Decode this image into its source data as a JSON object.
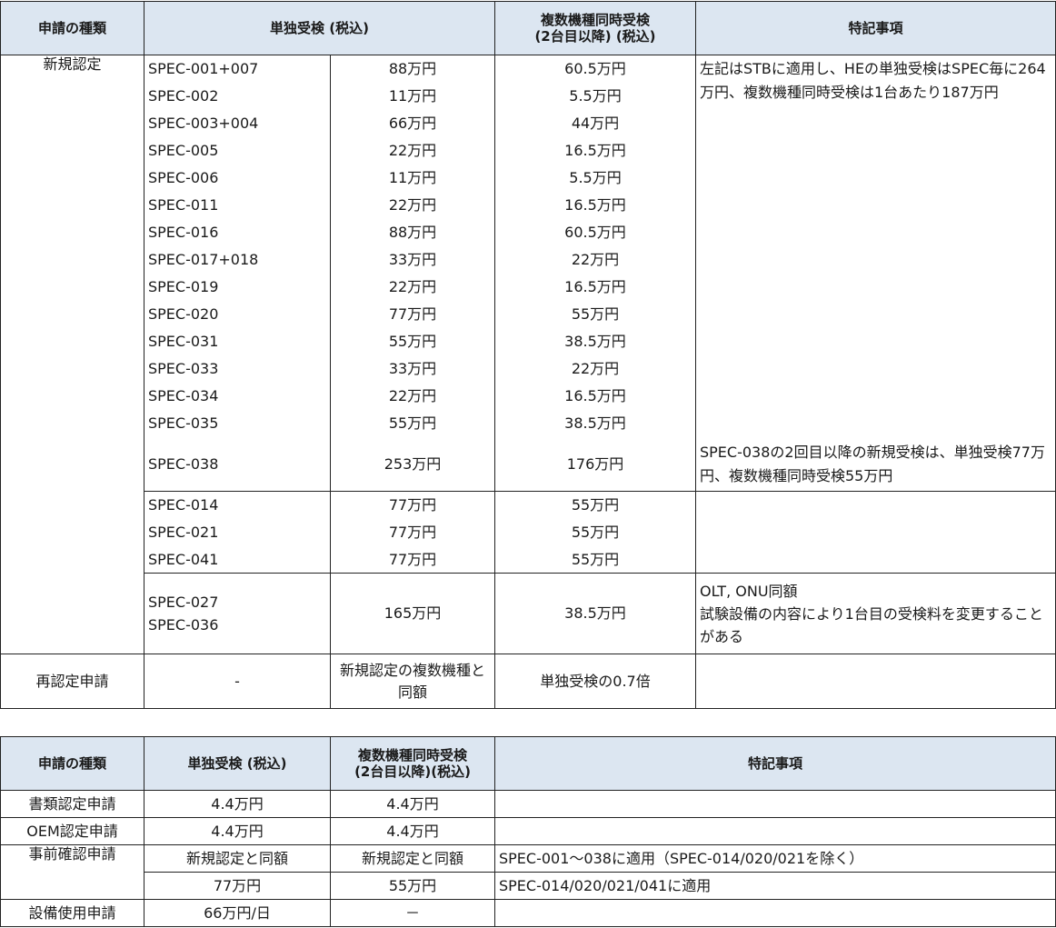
{
  "table1": {
    "headers": {
      "type": "申請の種類",
      "single": "単独受検 (税込)",
      "multi": "複数機種同時受検\n(2台目以降) (税込)",
      "notes": "特記事項"
    },
    "category_new": "新規認定",
    "group1": [
      {
        "spec": "SPEC-001+007",
        "single": "88万円",
        "multi": "60.5万円"
      },
      {
        "spec": "SPEC-002",
        "single": "11万円",
        "multi": "5.5万円"
      },
      {
        "spec": "SPEC-003+004",
        "single": "66万円",
        "multi": "44万円"
      },
      {
        "spec": "SPEC-005",
        "single": "22万円",
        "multi": "16.5万円"
      },
      {
        "spec": "SPEC-006",
        "single": "11万円",
        "multi": "5.5万円"
      },
      {
        "spec": "SPEC-011",
        "single": "22万円",
        "multi": "16.5万円"
      },
      {
        "spec": "SPEC-016",
        "single": "88万円",
        "multi": "60.5万円"
      },
      {
        "spec": "SPEC-017+018",
        "single": "33万円",
        "multi": "22万円"
      },
      {
        "spec": "SPEC-019",
        "single": "22万円",
        "multi": "16.5万円"
      },
      {
        "spec": "SPEC-020",
        "single": "77万円",
        "multi": "55万円"
      },
      {
        "spec": "SPEC-031",
        "single": "55万円",
        "multi": "38.5万円"
      },
      {
        "spec": "SPEC-033",
        "single": "33万円",
        "multi": "22万円"
      },
      {
        "spec": "SPEC-034",
        "single": "22万円",
        "multi": "16.5万円"
      },
      {
        "spec": "SPEC-035",
        "single": "55万円",
        "multi": "38.5万円"
      }
    ],
    "group1_note": "左記はSTBに適用し、HEの単独受検はSPEC毎に264万円、複数機種同時受検は1台あたり187万円",
    "spec038": {
      "spec": "SPEC-038",
      "single": "253万円",
      "multi": "176万円",
      "note": "SPEC-038の2回目以降の新規受検は、単独受検77万円、複数機種同時受検55万円"
    },
    "group2": [
      {
        "spec": "SPEC-014",
        "single": "77万円",
        "multi": "55万円"
      },
      {
        "spec": "SPEC-021",
        "single": "77万円",
        "multi": "55万円"
      },
      {
        "spec": "SPEC-041",
        "single": "77万円",
        "multi": "55万円"
      }
    ],
    "group3": {
      "spec": "SPEC-027\nSPEC-036",
      "single": "165万円",
      "multi": "38.5万円",
      "note": "OLT, ONU同額\n試験設備の内容により1台目の受検料を変更することがある"
    },
    "recert": {
      "type": "再認定申請",
      "spec": "-",
      "single": "新規認定の複数機種と同額",
      "multi": "単独受検の0.7倍",
      "note": ""
    }
  },
  "table2": {
    "headers": {
      "type": "申請の種類",
      "single": "単独受検 (税込)",
      "multi": "複数機種同時受検\n(2台目以降)(税込)",
      "notes": "特記事項"
    },
    "rows": [
      {
        "type": "書類認定申請",
        "single": "4.4万円",
        "multi": "4.4万円",
        "note": ""
      },
      {
        "type": "OEM認定申請",
        "single": "4.4万円",
        "multi": "4.4万円",
        "note": ""
      },
      {
        "type": "事前確認申請",
        "single": "新規認定と同額",
        "multi": "新規認定と同額",
        "note": "SPEC-001～038に適用（SPEC-014/020/021を除く）"
      },
      {
        "type": "",
        "single": "77万円",
        "multi": "55万円",
        "note": "SPEC-014/020/021/041に適用"
      },
      {
        "type": "設備使用申請",
        "single": "66万円/日",
        "multi": "－",
        "note": ""
      }
    ]
  }
}
